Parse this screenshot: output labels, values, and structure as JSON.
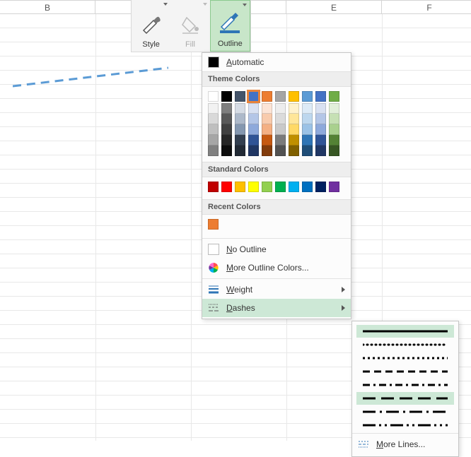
{
  "columns": {
    "b": "B",
    "c": "",
    "d": "",
    "e": "E",
    "f": "F"
  },
  "ribbon": {
    "style": "Style",
    "fill": "Fill",
    "outline": "Outline"
  },
  "menu": {
    "automatic": "Automatic",
    "theme_colors_hdr": "Theme Colors",
    "standard_colors_hdr": "Standard Colors",
    "recent_colors_hdr": "Recent Colors",
    "no_outline": "No Outline",
    "more_colors": "More Outline Colors...",
    "weight": "Weight",
    "dashes": "Dashes",
    "more_lines": "More Lines..."
  },
  "underlined": {
    "automatic_u": "A",
    "automatic_rest": "utomatic",
    "no_outline_u": "N",
    "no_outline_rest": "o Outline",
    "more_colors_u": "M",
    "more_colors_rest": "ore Outline Colors...",
    "weight_u": "W",
    "weight_rest": "eight",
    "dashes_u": "D",
    "dashes_rest": "ashes",
    "more_lines_u": "M",
    "more_lines_rest": "ore Lines..."
  },
  "theme_row": [
    "#ffffff",
    "#000000",
    "#44546a",
    "#4472c4",
    "#ed7d31",
    "#a5a5a5",
    "#ffc000",
    "#5b9bd5",
    "#4472c4",
    "#70ad47"
  ],
  "theme_shades": [
    [
      "#f2f2f2",
      "#d9d9d9",
      "#bfbfbf",
      "#a6a6a6",
      "#808080"
    ],
    [
      "#7f7f7f",
      "#595959",
      "#404040",
      "#262626",
      "#0d0d0d"
    ],
    [
      "#d6dce5",
      "#adb9ca",
      "#8497b0",
      "#333f50",
      "#222a35"
    ],
    [
      "#d9e1f2",
      "#b4c6e7",
      "#8ea9db",
      "#305496",
      "#203764"
    ],
    [
      "#fce4d6",
      "#f8cbad",
      "#f4b084",
      "#c65911",
      "#833c0c"
    ],
    [
      "#ededed",
      "#dbdbdb",
      "#c9c9c9",
      "#7b7b7b",
      "#525252"
    ],
    [
      "#fff2cc",
      "#ffe699",
      "#ffd966",
      "#bf8f00",
      "#806000"
    ],
    [
      "#ddebf7",
      "#bdd7ee",
      "#9bc2e6",
      "#2f75b5",
      "#1f4e78"
    ],
    [
      "#d9e1f2",
      "#b4c6e7",
      "#8ea9db",
      "#305496",
      "#203764"
    ],
    [
      "#e2efda",
      "#c6e0b4",
      "#a9d08e",
      "#548235",
      "#375623"
    ]
  ],
  "standard_colors": [
    "#c00000",
    "#ff0000",
    "#ffc000",
    "#ffff00",
    "#92d050",
    "#00b050",
    "#00b0f0",
    "#0070c0",
    "#002060",
    "#7030a0"
  ],
  "recent_colors": [
    "#ed7d31"
  ],
  "selected_theme_index": 3,
  "line_shape": {
    "color": "#5b9bd5",
    "dash": "8 8",
    "width": 3
  }
}
